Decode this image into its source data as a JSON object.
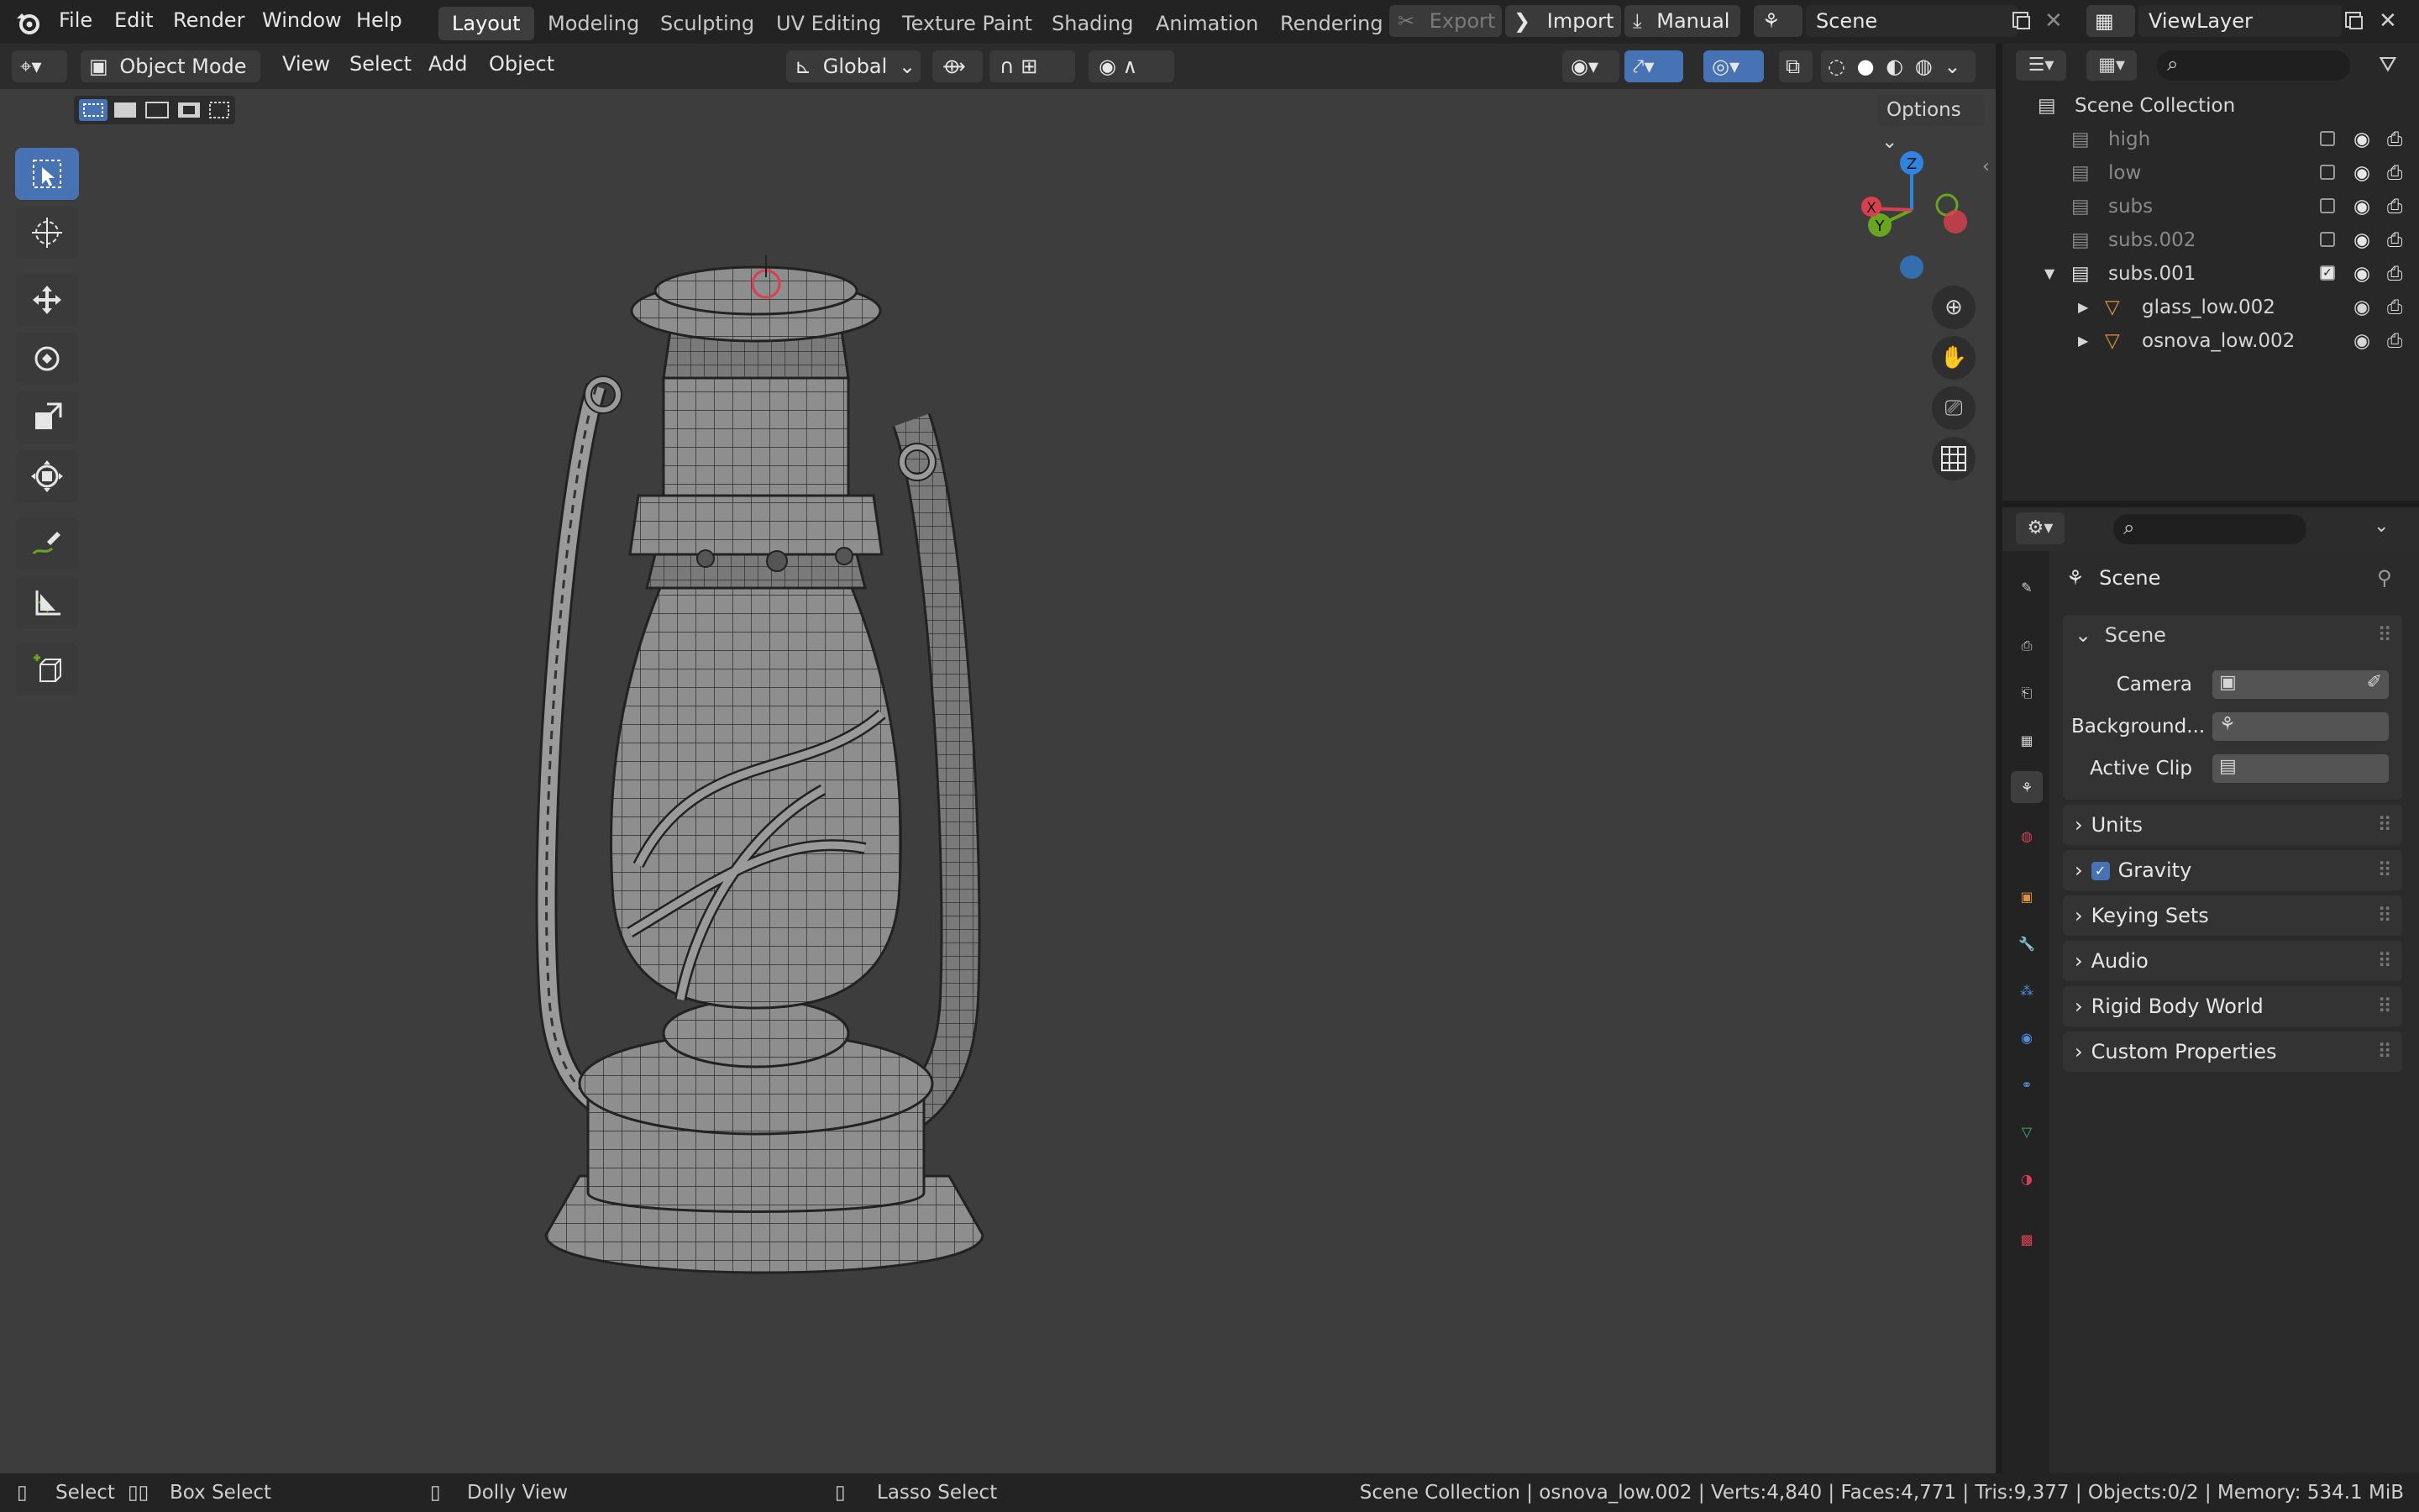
{
  "menu": {
    "file": "File",
    "edit": "Edit",
    "render": "Render",
    "window": "Window",
    "help": "Help"
  },
  "workspaces": [
    "Layout",
    "Modeling",
    "Sculpting",
    "UV Editing",
    "Texture Paint",
    "Shading",
    "Animation",
    "Rendering"
  ],
  "top_buttons": {
    "export": "Export",
    "import": "Import",
    "manual": "Manual"
  },
  "scene_field": "Scene",
  "view_layer_field": "ViewLayer",
  "viewport_header": {
    "mode": "Object Mode",
    "menus": [
      "View",
      "Select",
      "Add",
      "Object"
    ],
    "orientation": "Global",
    "options": "Options"
  },
  "gizmo": {
    "z": "Z",
    "y": "Y",
    "x": "X"
  },
  "outliner": {
    "root": "Scene Collection",
    "rows": [
      {
        "label": "high",
        "checked": false,
        "dim": true
      },
      {
        "label": "low",
        "checked": false,
        "dim": true
      },
      {
        "label": "subs",
        "checked": false,
        "dim": true
      },
      {
        "label": "subs.002",
        "checked": false,
        "dim": true
      },
      {
        "label": "subs.001",
        "checked": true,
        "dim": false
      }
    ],
    "children": [
      {
        "label": "glass_low.002"
      },
      {
        "label": "osnova_low.002"
      }
    ]
  },
  "properties": {
    "context_title": "Scene",
    "panel_scene": "Scene",
    "camera_label": "Camera",
    "background_label": "Background...",
    "active_clip_label": "Active Clip",
    "collapsed_panels": [
      "Units",
      "Gravity",
      "Keying Sets",
      "Audio",
      "Rigid Body World",
      "Custom Properties"
    ]
  },
  "status": {
    "select": "Select",
    "box_select": "Box Select",
    "dolly_view": "Dolly View",
    "lasso_select": "Lasso Select",
    "stats": "Scene Collection | osnova_low.002 | Verts:4,840 | Faces:4,771 | Tris:9,377 | Objects:0/2 | Memory: 534.1 MiB"
  },
  "colors": {
    "accent": "#4772b3",
    "axis_x": "#d9404f",
    "axis_y": "#6aa51f",
    "axis_z": "#2f84e0",
    "object_orange": "#e08f3a"
  }
}
